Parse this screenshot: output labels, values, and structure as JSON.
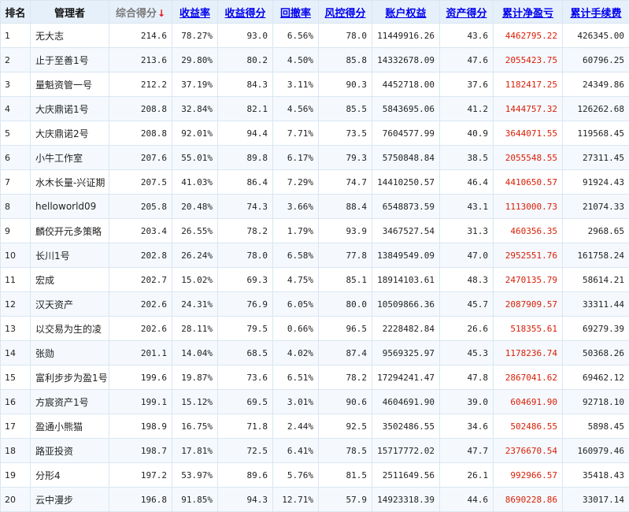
{
  "headers": {
    "rank": "排名",
    "manager": "管理者",
    "total_score": "综合得分",
    "sort_arrow": "↓",
    "return_rate": "收益率",
    "return_score": "收益得分",
    "drawdown": "回撤率",
    "risk_score": "风控得分",
    "equity": "账户权益",
    "asset_score": "资产得分",
    "net_pnl": "累计净盈亏",
    "fees": "累计手续费"
  },
  "colors": {
    "header_bg": "#e6f0fa",
    "link_blue": "#0000ee",
    "pnl_red": "#d81e06",
    "sort_arrow_red": "#e0121a",
    "border": "#d9e6f2"
  },
  "rows": [
    {
      "rank": "1",
      "name": "无大志",
      "total": "214.6",
      "ret": "78.27%",
      "retScore": "93.0",
      "dd": "6.56%",
      "risk": "78.0",
      "equity": "11449916.26",
      "asset": "43.6",
      "pnl": "4462795.22",
      "fee": "426345.00"
    },
    {
      "rank": "2",
      "name": "止于至善1号",
      "total": "213.6",
      "ret": "29.80%",
      "retScore": "80.2",
      "dd": "4.50%",
      "risk": "85.8",
      "equity": "14332678.09",
      "asset": "47.6",
      "pnl": "2055423.75",
      "fee": "60796.25"
    },
    {
      "rank": "3",
      "name": "量魁资管一号",
      "total": "212.2",
      "ret": "37.19%",
      "retScore": "84.3",
      "dd": "3.11%",
      "risk": "90.3",
      "equity": "4452718.00",
      "asset": "37.6",
      "pnl": "1182417.25",
      "fee": "24349.86"
    },
    {
      "rank": "4",
      "name": "大庆鼎诺1号",
      "total": "208.8",
      "ret": "32.84%",
      "retScore": "82.1",
      "dd": "4.56%",
      "risk": "85.5",
      "equity": "5843695.06",
      "asset": "41.2",
      "pnl": "1444757.32",
      "fee": "126262.68"
    },
    {
      "rank": "5",
      "name": "大庆鼎诺2号",
      "total": "208.8",
      "ret": "92.01%",
      "retScore": "94.4",
      "dd": "7.71%",
      "risk": "73.5",
      "equity": "7604577.99",
      "asset": "40.9",
      "pnl": "3644071.55",
      "fee": "119568.45"
    },
    {
      "rank": "6",
      "name": "小牛工作室",
      "total": "207.6",
      "ret": "55.01%",
      "retScore": "89.8",
      "dd": "6.17%",
      "risk": "79.3",
      "equity": "5750848.84",
      "asset": "38.5",
      "pnl": "2055548.55",
      "fee": "27311.45"
    },
    {
      "rank": "7",
      "name": "水木长量-兴证期",
      "total": "207.5",
      "ret": "41.03%",
      "retScore": "86.4",
      "dd": "7.29%",
      "risk": "74.7",
      "equity": "14410250.57",
      "asset": "46.4",
      "pnl": "4410650.57",
      "fee": "91924.43"
    },
    {
      "rank": "8",
      "name": "helloworld09",
      "total": "205.8",
      "ret": "20.48%",
      "retScore": "74.3",
      "dd": "3.66%",
      "risk": "88.4",
      "equity": "6548873.59",
      "asset": "43.1",
      "pnl": "1113000.73",
      "fee": "21074.33"
    },
    {
      "rank": "9",
      "name": "麟佼开元多策略",
      "total": "203.4",
      "ret": "26.55%",
      "retScore": "78.2",
      "dd": "1.79%",
      "risk": "93.9",
      "equity": "3467527.54",
      "asset": "31.3",
      "pnl": "460356.35",
      "fee": "2968.65"
    },
    {
      "rank": "10",
      "name": "长川1号",
      "total": "202.8",
      "ret": "26.24%",
      "retScore": "78.0",
      "dd": "6.58%",
      "risk": "77.8",
      "equity": "13849549.09",
      "asset": "47.0",
      "pnl": "2952551.76",
      "fee": "161758.24"
    },
    {
      "rank": "11",
      "name": "宏成",
      "total": "202.7",
      "ret": "15.02%",
      "retScore": "69.3",
      "dd": "4.75%",
      "risk": "85.1",
      "equity": "18914103.61",
      "asset": "48.3",
      "pnl": "2470135.79",
      "fee": "58614.21"
    },
    {
      "rank": "12",
      "name": "汉天资产",
      "total": "202.6",
      "ret": "24.31%",
      "retScore": "76.9",
      "dd": "6.05%",
      "risk": "80.0",
      "equity": "10509866.36",
      "asset": "45.7",
      "pnl": "2087909.57",
      "fee": "33311.44"
    },
    {
      "rank": "13",
      "name": "以交易为生的凌",
      "total": "202.6",
      "ret": "28.11%",
      "retScore": "79.5",
      "dd": "0.66%",
      "risk": "96.5",
      "equity": "2228482.84",
      "asset": "26.6",
      "pnl": "518355.61",
      "fee": "69279.39"
    },
    {
      "rank": "14",
      "name": "张勋",
      "total": "201.1",
      "ret": "14.04%",
      "retScore": "68.5",
      "dd": "4.02%",
      "risk": "87.4",
      "equity": "9569325.97",
      "asset": "45.3",
      "pnl": "1178236.74",
      "fee": "50368.26"
    },
    {
      "rank": "15",
      "name": "富利步步为盈1号",
      "total": "199.6",
      "ret": "19.87%",
      "retScore": "73.6",
      "dd": "6.51%",
      "risk": "78.2",
      "equity": "17294241.47",
      "asset": "47.8",
      "pnl": "2867041.62",
      "fee": "69462.12"
    },
    {
      "rank": "16",
      "name": "方宸资产1号",
      "total": "199.1",
      "ret": "15.12%",
      "retScore": "69.5",
      "dd": "3.01%",
      "risk": "90.6",
      "equity": "4604691.90",
      "asset": "39.0",
      "pnl": "604691.90",
      "fee": "92718.10"
    },
    {
      "rank": "17",
      "name": "盈通小熊猫",
      "total": "198.9",
      "ret": "16.75%",
      "retScore": "71.8",
      "dd": "2.44%",
      "risk": "92.5",
      "equity": "3502486.55",
      "asset": "34.6",
      "pnl": "502486.55",
      "fee": "5898.45"
    },
    {
      "rank": "18",
      "name": "路亚投资",
      "total": "198.7",
      "ret": "17.81%",
      "retScore": "72.5",
      "dd": "6.41%",
      "risk": "78.5",
      "equity": "15717772.02",
      "asset": "47.7",
      "pnl": "2376670.54",
      "fee": "160979.46"
    },
    {
      "rank": "19",
      "name": "分形4",
      "total": "197.2",
      "ret": "53.97%",
      "retScore": "89.6",
      "dd": "5.76%",
      "risk": "81.5",
      "equity": "2511649.56",
      "asset": "26.1",
      "pnl": "992966.57",
      "fee": "35418.43"
    },
    {
      "rank": "20",
      "name": "云中漫步",
      "total": "196.8",
      "ret": "91.85%",
      "retScore": "94.3",
      "dd": "12.71%",
      "risk": "57.9",
      "equity": "14923318.39",
      "asset": "44.6",
      "pnl": "8690228.86",
      "fee": "33017.14"
    }
  ]
}
